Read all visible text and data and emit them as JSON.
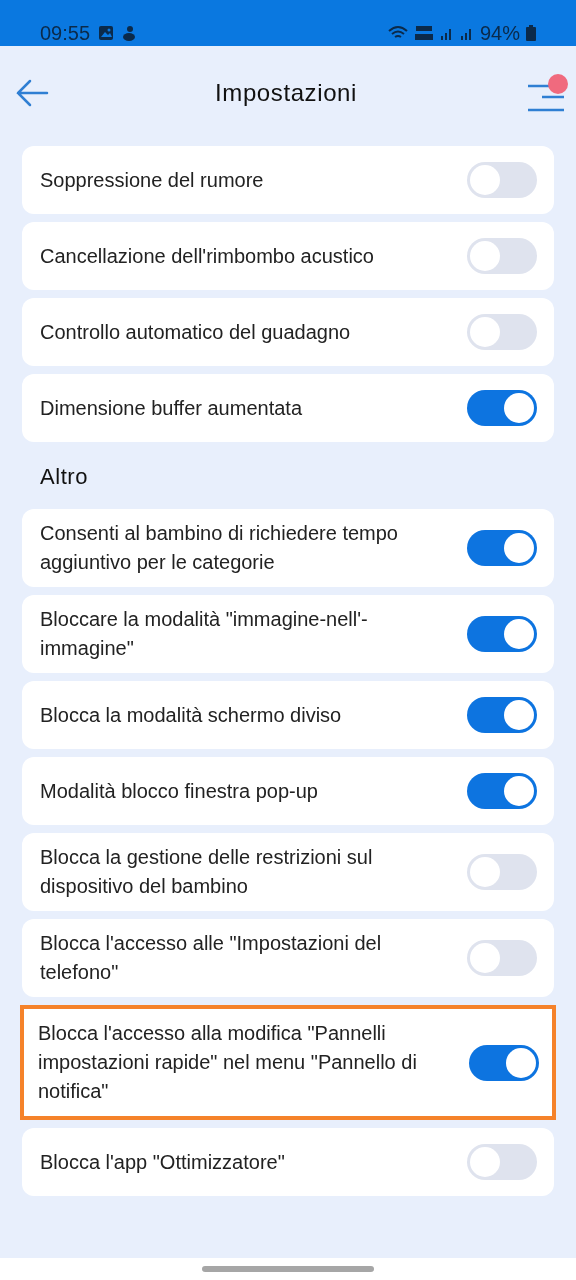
{
  "status_bar": {
    "time": "09:55",
    "battery": "94%"
  },
  "header": {
    "title": "Impostazioni",
    "menu_badge": true
  },
  "groups": [
    {
      "items": [
        {
          "label": "Soppressione del rumore",
          "on": false,
          "highlighted": false
        },
        {
          "label": "Cancellazione dell'rimbombo acustico",
          "on": false,
          "highlighted": false
        },
        {
          "label": "Controllo automatico del guadagno",
          "on": false,
          "highlighted": false
        },
        {
          "label": "Dimensione buffer aumentata",
          "on": true,
          "highlighted": false
        }
      ]
    },
    {
      "heading": "Altro",
      "items": [
        {
          "label": "Consenti al bambino di richiedere tempo aggiuntivo per le categorie",
          "on": true,
          "highlighted": false
        },
        {
          "label": "Bloccare la modalità \"immagine-nell'-immagine\"",
          "on": true,
          "highlighted": false
        },
        {
          "label": "Blocca la modalità schermo diviso",
          "on": true,
          "highlighted": false
        },
        {
          "label": "Modalità blocco finestra pop-up",
          "on": true,
          "highlighted": false
        },
        {
          "label": "Blocca la gestione delle restrizioni sul dispositivo del bambino",
          "on": false,
          "highlighted": false
        },
        {
          "label": "Blocca l'accesso alle \"Impostazioni del telefono\"",
          "on": false,
          "highlighted": false
        },
        {
          "label": "Blocca l'accesso alla modifica \"Pannelli impostazioni rapide\" nel menu \"Pannello di notifica\"",
          "on": true,
          "highlighted": true
        },
        {
          "label": "Blocca l'app \"Ottimizzatore\"",
          "on": false,
          "highlighted": false
        }
      ]
    }
  ]
}
